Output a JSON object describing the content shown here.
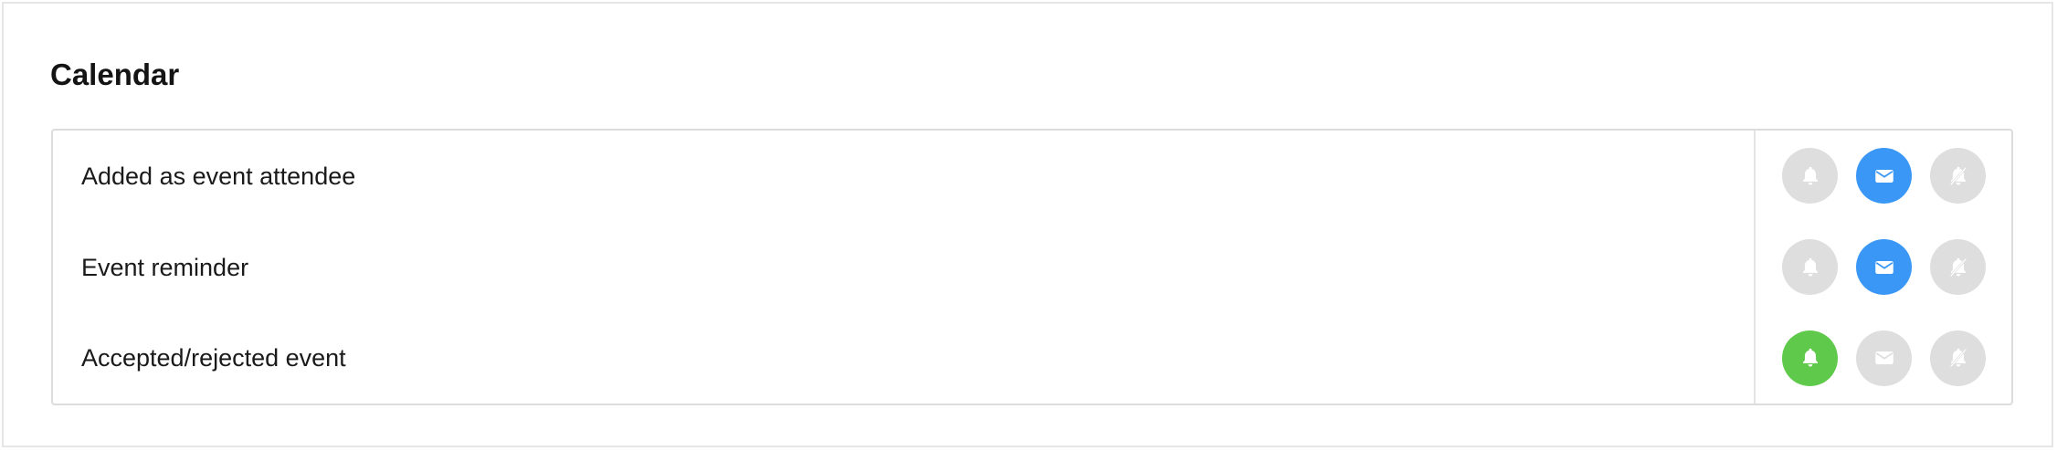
{
  "section": {
    "title": "Calendar"
  },
  "colors": {
    "inactive": "#dedede",
    "email_active": "#3a97f6",
    "push_active": "#5fc94b",
    "icon": "#ffffff"
  },
  "rows": [
    {
      "label": "Added as event attendee",
      "channels": [
        {
          "icon": "bell-icon",
          "active": false
        },
        {
          "icon": "envelope-icon",
          "active": true
        },
        {
          "icon": "bell-slash-icon",
          "active": false
        }
      ]
    },
    {
      "label": "Event reminder",
      "channels": [
        {
          "icon": "bell-icon",
          "active": false
        },
        {
          "icon": "envelope-icon",
          "active": true
        },
        {
          "icon": "bell-slash-icon",
          "active": false
        }
      ]
    },
    {
      "label": "Accepted/rejected event",
      "channels": [
        {
          "icon": "bell-icon",
          "active": true
        },
        {
          "icon": "envelope-icon",
          "active": false
        },
        {
          "icon": "bell-slash-icon",
          "active": false
        }
      ]
    }
  ]
}
